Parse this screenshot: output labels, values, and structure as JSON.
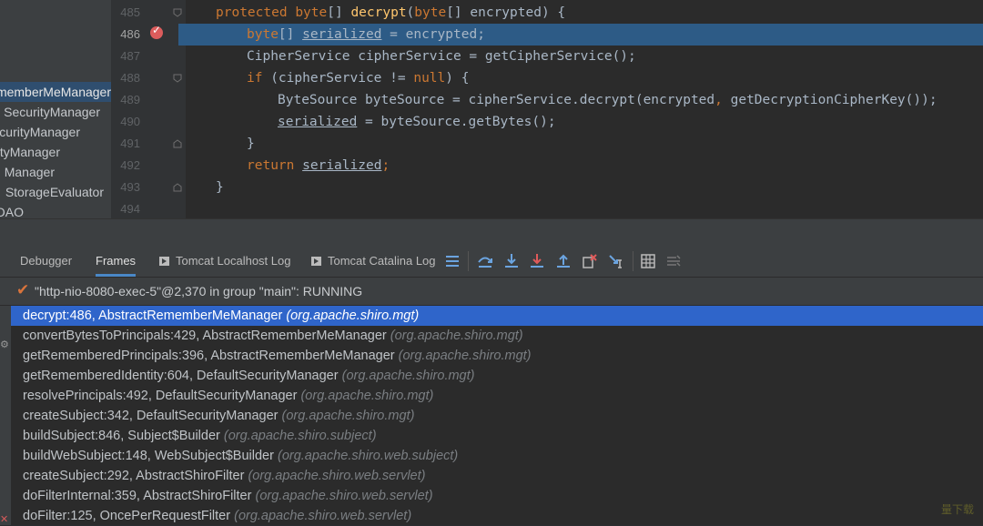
{
  "project_tree": {
    "items": [
      {
        "label": "rememberMeManager"
      },
      {
        "label": "SecurityManager"
      },
      {
        "label": "curityManager"
      },
      {
        "label": "ityManager"
      },
      {
        "label": "Manager"
      },
      {
        "label": "StorageEvaluator"
      },
      {
        "label": "DAO"
      }
    ]
  },
  "editor": {
    "line_numbers": [
      "485",
      "486",
      "487",
      "488",
      "489",
      "490",
      "491",
      "492",
      "493",
      "494"
    ],
    "current_line": "486",
    "code": {
      "l485": {
        "kw": "protected",
        "t1": " ",
        "kw2": "byte",
        "t2": "[] ",
        "fn": "decrypt",
        "t3": "(",
        "kw3": "byte",
        "t4": "[] encrypted) {"
      },
      "l486": {
        "kw": "byte",
        "t1": "[] ",
        "var": "serialized",
        "t2": " = encrypted;"
      },
      "l487": {
        "t1": "CipherService cipherService = getCipherService();"
      },
      "l488": {
        "kw": "if",
        "t1": " (cipherService != ",
        "kw2": "null",
        "t2": ") {"
      },
      "l489": {
        "t1": "ByteSource byteSource = cipherService.decrypt(encrypted",
        "c": ",",
        "t2": " getDecryptionCipherKey());"
      },
      "l490": {
        "var": "serialized",
        "t1": " = byteSource.getBytes();"
      },
      "l491": {
        "t1": "}"
      },
      "l492": {
        "kw": "return",
        "t1": " ",
        "var": "serialized",
        "t2": ";"
      },
      "l493": {
        "t1": "}"
      }
    }
  },
  "tabs": {
    "debugger": "Debugger",
    "frames": "Frames",
    "tomcat_localhost": "Tomcat Localhost Log",
    "tomcat_catalina": "Tomcat Catalina Log"
  },
  "toolbar_icons": [
    "menu-icon",
    "step-over-icon",
    "step-into-icon",
    "force-step-into-icon",
    "step-out-icon",
    "drop-frame-icon",
    "run-to-cursor-icon",
    "evaluate-icon",
    "trace-icon"
  ],
  "thread": {
    "status": "\"http-nio-8080-exec-5\"@2,370 in group \"main\": RUNNING"
  },
  "frames": [
    {
      "method": "decrypt:486, AbstractRememberMeManager",
      "pkg": "(org.apache.shiro.mgt)"
    },
    {
      "method": "convertBytesToPrincipals:429, AbstractRememberMeManager",
      "pkg": "(org.apache.shiro.mgt)"
    },
    {
      "method": "getRememberedPrincipals:396, AbstractRememberMeManager",
      "pkg": "(org.apache.shiro.mgt)"
    },
    {
      "method": "getRememberedIdentity:604, DefaultSecurityManager",
      "pkg": "(org.apache.shiro.mgt)"
    },
    {
      "method": "resolvePrincipals:492, DefaultSecurityManager",
      "pkg": "(org.apache.shiro.mgt)"
    },
    {
      "method": "createSubject:342, DefaultSecurityManager",
      "pkg": "(org.apache.shiro.mgt)"
    },
    {
      "method": "buildSubject:846, Subject$Builder",
      "pkg": "(org.apache.shiro.subject)"
    },
    {
      "method": "buildWebSubject:148, WebSubject$Builder",
      "pkg": "(org.apache.shiro.web.subject)"
    },
    {
      "method": "createSubject:292, AbstractShiroFilter",
      "pkg": "(org.apache.shiro.web.servlet)"
    },
    {
      "method": "doFilterInternal:359, AbstractShiroFilter",
      "pkg": "(org.apache.shiro.web.servlet)"
    },
    {
      "method": "doFilter:125, OncePerRequestFilter",
      "pkg": "(org.apache.shiro.web.servlet)"
    }
  ],
  "watermark": "量下载",
  "colors": {
    "selection": "#2f65ca",
    "keyword": "#cc7832",
    "function": "#ffc66d",
    "current_line": "#2d5b86"
  }
}
